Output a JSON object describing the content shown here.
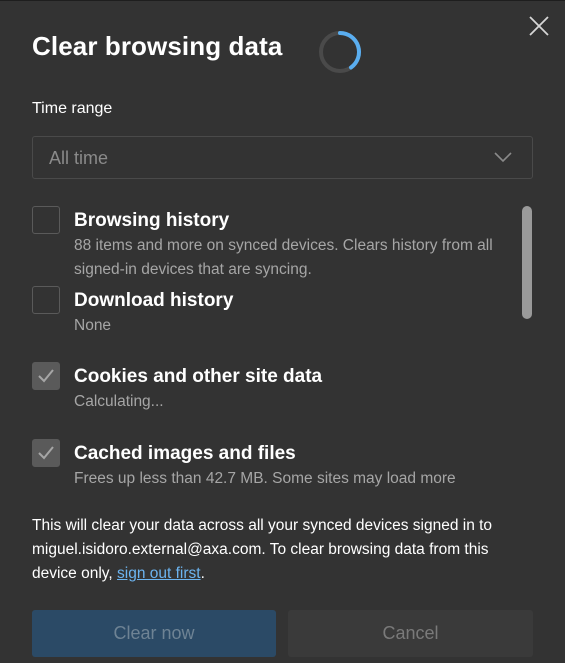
{
  "dialog": {
    "title": "Clear browsing data",
    "close_icon": "close-icon",
    "loading_icon": "loading-spinner-icon"
  },
  "time_range": {
    "label": "Time range",
    "value": "All time",
    "chevron_icon": "chevron-down-icon"
  },
  "items": [
    {
      "title": "Browsing history",
      "description": "88 items and more on synced devices. Clears history from all signed-in devices that are syncing.",
      "checked": false
    },
    {
      "title": "Download history",
      "description": "None",
      "checked": false
    },
    {
      "title": "Cookies and other site data",
      "description": "Calculating...",
      "checked": true
    },
    {
      "title": "Cached images and files",
      "description": "Frees up less than 42.7 MB. Some sites may load more",
      "checked": true
    }
  ],
  "notice": {
    "text": "This will clear your data across all your synced devices signed in to miguel.isidoro.external@axa.com. To clear browsing data from this device only, ",
    "link": "sign out first",
    "suffix": "."
  },
  "buttons": {
    "clear": "Clear now",
    "cancel": "Cancel"
  },
  "colors": {
    "background": "#333333",
    "accent": "#6cb4f0",
    "primary_button_disabled": "#2b4a66"
  }
}
